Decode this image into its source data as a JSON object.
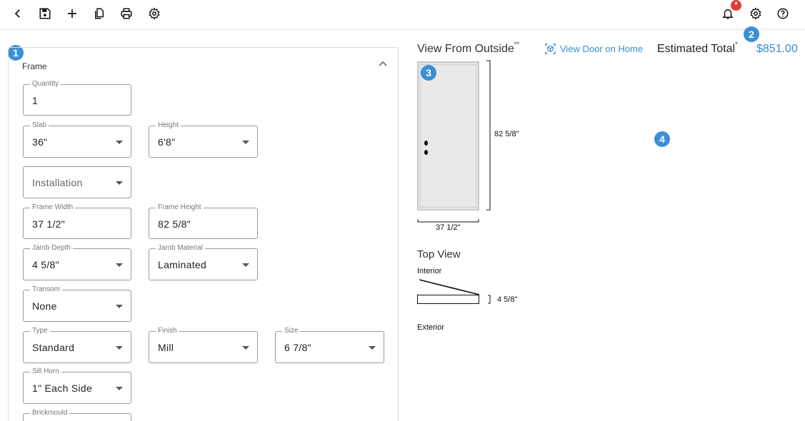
{
  "toolbar": {
    "icons": [
      "back-icon",
      "save-icon",
      "add-icon",
      "copy-icon",
      "print-icon",
      "settings-icon"
    ],
    "right_icons": [
      "notification-icon",
      "settings-icon",
      "help-icon"
    ],
    "notification_badge": "*"
  },
  "steps": [
    "1",
    "2",
    "3",
    "4"
  ],
  "panel": {
    "title": "Frame",
    "fields": {
      "quantity": {
        "label": "Quantity",
        "value": "1"
      },
      "slab": {
        "label": "Slab",
        "value": "36\""
      },
      "height": {
        "label": "Height",
        "value": "6'8\""
      },
      "installation": {
        "placeholder": "Installation"
      },
      "frame_width": {
        "label": "Frame Width",
        "value": "37 1/2\""
      },
      "frame_height": {
        "label": "Frame Height",
        "value": "82 5/8\""
      },
      "jamb_depth": {
        "label": "Jamb Depth",
        "value": "4 5/8\""
      },
      "jamb_material": {
        "label": "Jamb Material",
        "value": "Laminated"
      },
      "transom": {
        "label": "Transom",
        "value": "None"
      },
      "type": {
        "label": "Type",
        "value": "Standard"
      },
      "finish": {
        "label": "Finish",
        "value": "Mill"
      },
      "size": {
        "label": "Size",
        "value": "6 7/8\""
      },
      "sill_horn": {
        "label": "Sill Horn",
        "value": "1\" Each Side"
      },
      "brickmould": {
        "label": "Brickmould",
        "value": ""
      }
    }
  },
  "preview": {
    "view_title": "View From Outside",
    "view_title_sup": "**",
    "view_door_link": "View Door on Home",
    "estimated_label": "Estimated Total",
    "estimated_sup": "*",
    "estimated_value": "$851.00",
    "door_height_dim": "82 5/8\"",
    "door_width_dim": "37 1/2\"",
    "top_view_title": "Top View",
    "interior_label": "Interior",
    "exterior_label": "Exterior",
    "depth_dim": "4 5/8\""
  },
  "colors": {
    "accent": "#3a8bd4",
    "step_badge": "#3d8fd6",
    "notification": "#e53935"
  }
}
